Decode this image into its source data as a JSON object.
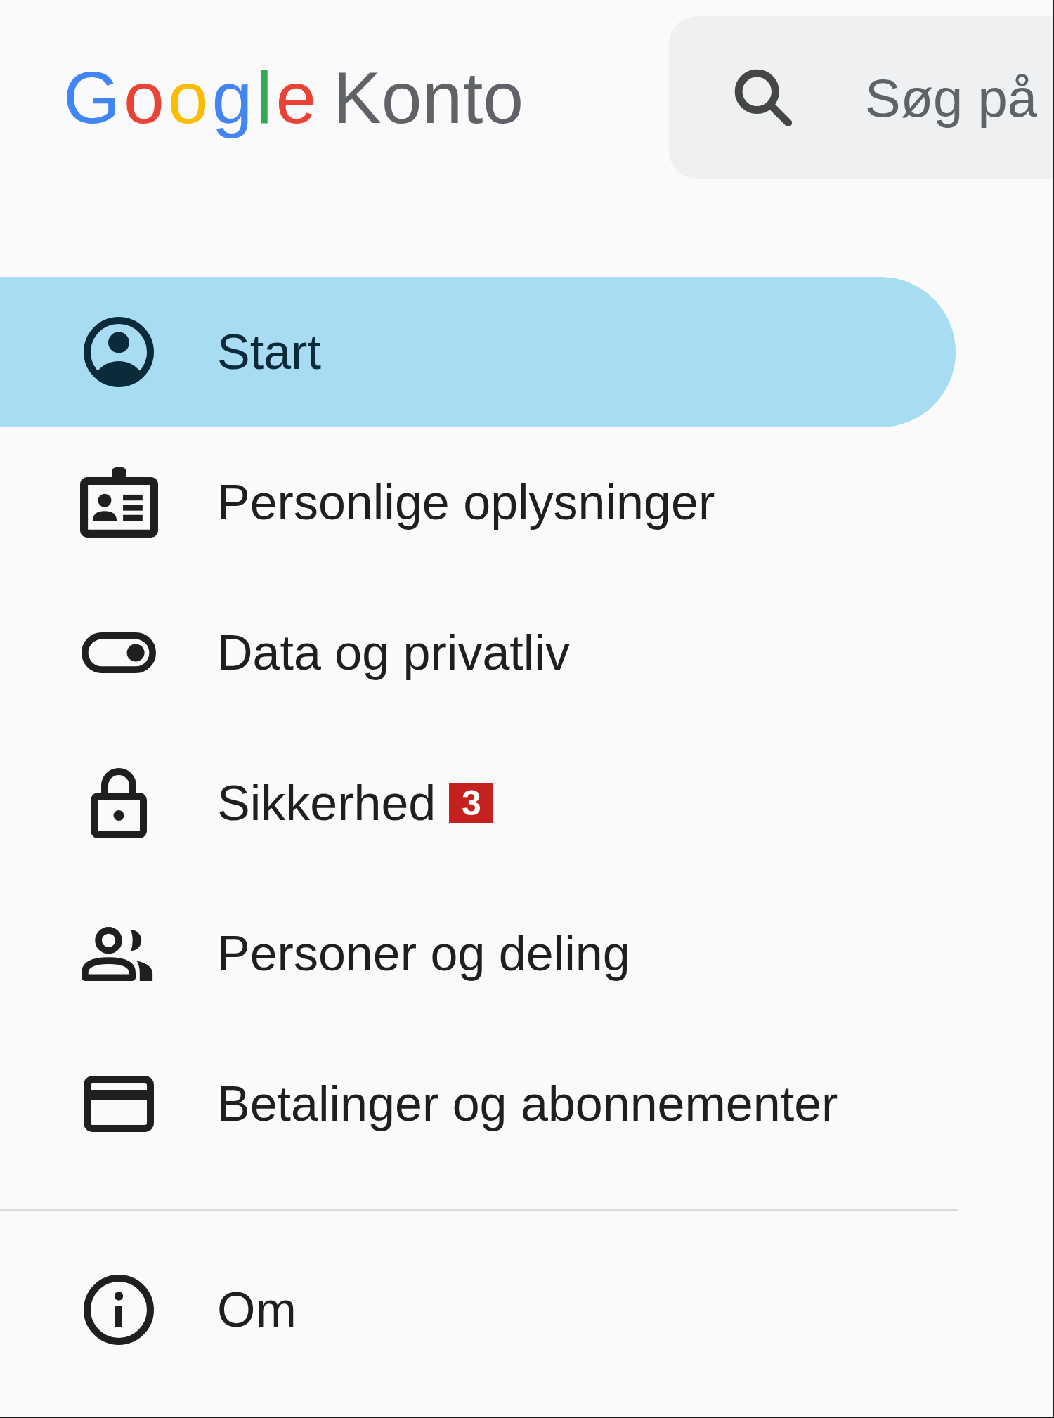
{
  "header": {
    "logo": {
      "brand": "Google",
      "product": "Konto"
    },
    "search": {
      "placeholder": "Søg på"
    }
  },
  "nav": {
    "items": [
      {
        "label": "Start",
        "selected": true
      },
      {
        "label": "Personlige oplysninger",
        "selected": false
      },
      {
        "label": "Data og privatliv",
        "selected": false
      },
      {
        "label": "Sikkerhed",
        "selected": false,
        "badge": "3"
      },
      {
        "label": "Personer og deling",
        "selected": false
      },
      {
        "label": "Betalinger og abonnementer",
        "selected": false
      }
    ]
  },
  "footer_nav": {
    "items": [
      {
        "label": "Om",
        "selected": false
      }
    ]
  }
}
